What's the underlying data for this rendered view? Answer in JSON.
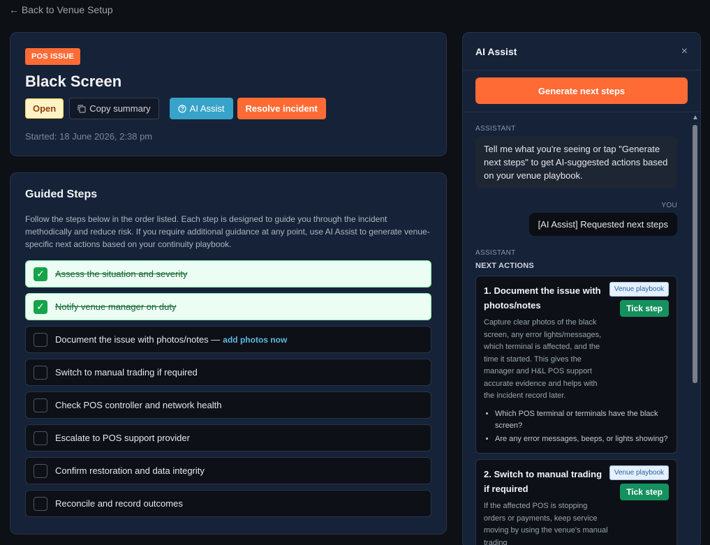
{
  "nav": {
    "back_label": "← Back to Venue Setup"
  },
  "incident": {
    "type_badge": "POS ISSUE",
    "title": "Black Screen",
    "status": "Open",
    "copy_label": "Copy summary",
    "ai_assist_label": "AI Assist",
    "resolve_label": "Resolve incident",
    "started": "Started: 18 June 2026, 2:38 pm"
  },
  "guided_steps": {
    "title": "Guided Steps",
    "description": "Follow the steps below in the order listed. Each step is designed to guide you through the incident methodically and reduce risk. If you require additional guidance at any point, use AI Assist to generate venue-specific next actions based on your continuity playbook.",
    "steps": [
      {
        "label": "Assess the situation and severity",
        "done": true,
        "check": "✓"
      },
      {
        "label": "Notify venue manager on duty",
        "done": true,
        "check": "✓"
      },
      {
        "label": "Document the issue with photos/notes —",
        "done": false,
        "link": "add photos now"
      },
      {
        "label": "Switch to manual trading if required",
        "done": false
      },
      {
        "label": "Check POS controller and network health",
        "done": false
      },
      {
        "label": "Escalate to POS support provider",
        "done": false
      },
      {
        "label": "Confirm restoration and data integrity",
        "done": false
      },
      {
        "label": "Reconcile and record outcomes",
        "done": false
      }
    ]
  },
  "ai_panel": {
    "title": "AI Assist",
    "close_icon": "×",
    "generate_label": "Generate next steps",
    "assistant_label": "ASSISTANT",
    "you_label": "YOU",
    "assistant_msg": "Tell me what you're seeing or tap \"Generate next steps\" to get AI-suggested actions based on your venue playbook.",
    "user_msg": "[AI Assist] Requested next steps",
    "assistant_label_2": "ASSISTANT",
    "next_actions_label": "NEXT ACTIONS",
    "actions": [
      {
        "title": "1. Document the issue with photos/notes",
        "playbook_tag": "Venue playbook",
        "tick_label": "Tick step",
        "description": "Capture clear photos of the black screen, any error lights/messages, which terminal is affected, and the time it started. This gives the manager and H&L POS support accurate evidence and helps with the incident record later.",
        "bullets": [
          "Which POS terminal or terminals have the black screen?",
          "Are any error messages, beeps, or lights showing?"
        ]
      },
      {
        "title": "2. Switch to manual trading if required",
        "playbook_tag": "Venue playbook",
        "tick_label": "Tick step",
        "description": "If the affected POS is stopping orders or payments, keep service moving by using the venue's manual trading",
        "bullets": []
      }
    ]
  }
}
